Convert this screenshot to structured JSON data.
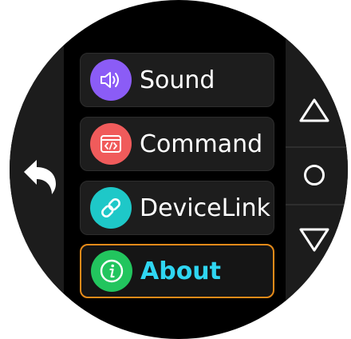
{
  "menu": {
    "items": [
      {
        "label": "Sound",
        "icon": "speaker-icon",
        "color": "#8b5cf6",
        "selected": false
      },
      {
        "label": "Command",
        "icon": "code-terminal-icon",
        "color": "#f05b5b",
        "selected": false
      },
      {
        "label": "DeviceLink",
        "icon": "link-icon",
        "color": "#1ec8c8",
        "selected": false
      },
      {
        "label": "About",
        "icon": "info-icon",
        "color": "#22c55e",
        "selected": true
      }
    ]
  },
  "navigation": {
    "back_icon": "back-arrow-icon",
    "up_icon": "triangle-up-icon",
    "select_icon": "circle-icon",
    "down_icon": "triangle-down-icon"
  },
  "colors": {
    "selected_border": "#e58a19",
    "selected_text": "#2fd6f2",
    "background": "#000000",
    "rail": "#1c1c1c"
  }
}
